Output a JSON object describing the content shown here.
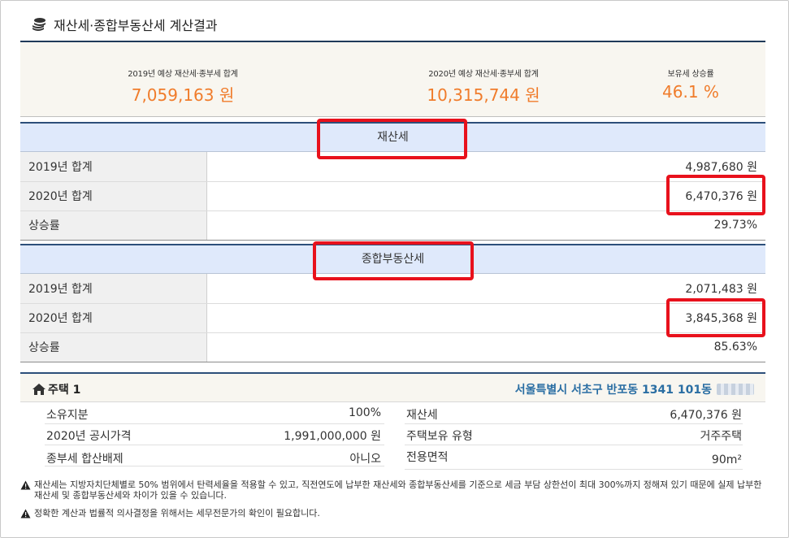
{
  "header": {
    "title": "재산세·종합부동산세 계산결과",
    "icon": "coins-icon"
  },
  "summary": {
    "y2019": {
      "label": "2019년 예상 재산세·종부세 합계",
      "value": "7,059,163 원"
    },
    "y2020": {
      "label": "2020년 예상 재산세·종부세 합계",
      "value": "10,315,744 원"
    },
    "increase": {
      "label": "보유세 상승률",
      "value": "46.1 %"
    },
    "accent_color": "#f07c2b"
  },
  "property_tax": {
    "heading": "재산세",
    "rows": [
      {
        "label": "2019년 합계",
        "value": "4,987,680 원"
      },
      {
        "label": "2020년 합계",
        "value": "6,470,376 원"
      },
      {
        "label": "상승률",
        "value": "29.73%"
      }
    ]
  },
  "comprehensive_tax": {
    "heading": "종합부동산세",
    "rows": [
      {
        "label": "2019년 합계",
        "value": "2,071,483 원"
      },
      {
        "label": "2020년 합계",
        "value": "3,845,368 원"
      },
      {
        "label": "상승률",
        "value": "85.63%"
      }
    ]
  },
  "house": {
    "title": "주택 1",
    "icon": "home-icon",
    "address": "서울특별시 서초구 반포동 1341 101동",
    "details_left": [
      {
        "label": "소유지분",
        "value": "100%"
      },
      {
        "label": "2020년 공시가격",
        "value": "1,991,000,000 원"
      },
      {
        "label": "종부세 합산배제",
        "value": "아니오"
      }
    ],
    "details_right": [
      {
        "label": "재산세",
        "value": "6,470,376 원"
      },
      {
        "label": "주택보유 유형",
        "value": "거주주택"
      },
      {
        "label": "전용면적",
        "value": "90m²"
      }
    ]
  },
  "notes": [
    "재산세는 지방자치단체별로 50% 범위에서 탄력세율을 적용할 수 있고, 직전연도에 납부한 재산세와 종합부동산세를 기준으로 세금 부담 상한선이 최대 300%까지 정해져 있기 때문에 실제 납부한 재산세 및 종합부동산세와 차이가 있을 수 있습니다.",
    "정확한 계산과 법률적 의사결정을 위해서는 세무전문가의 확인이 필요합니다."
  ],
  "highlight_color": "#e8111c"
}
